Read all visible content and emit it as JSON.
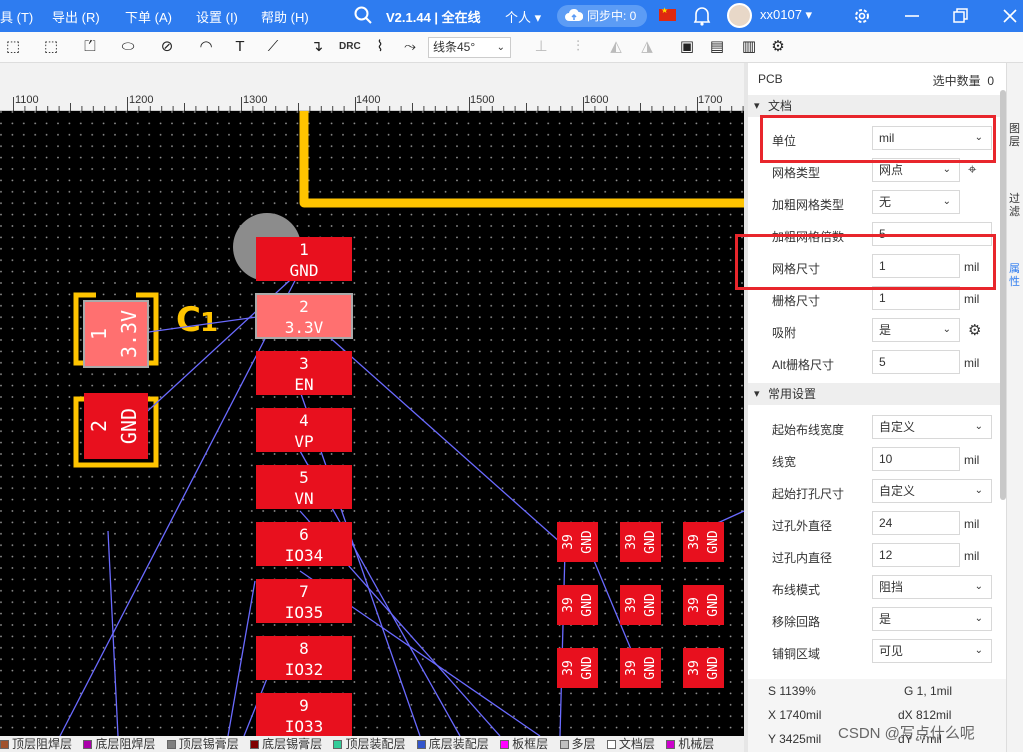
{
  "menubar": {
    "items": [
      "具 (T)",
      "导出 (R)",
      "下单 (A)",
      "设置 (I)",
      "帮助 (H)"
    ],
    "version": "V2.1.44 | 全在线",
    "account_mode": "个人",
    "sync": "同步中: 0",
    "username": "xx0107"
  },
  "toolbar": {
    "drc": "DRC",
    "line_mode": "线条45°"
  },
  "ruler": {
    "ticks": [
      "1100",
      "1200",
      "1300",
      "1400",
      "1500",
      "1600",
      "1700"
    ]
  },
  "canvas": {
    "pads_main": [
      {
        "num": "1",
        "net": "GND"
      },
      {
        "num": "2",
        "net": "3.3V"
      },
      {
        "num": "3",
        "net": "EN"
      },
      {
        "num": "4",
        "net": "VP"
      },
      {
        "num": "5",
        "net": "VN"
      },
      {
        "num": "6",
        "net": "IO34"
      },
      {
        "num": "7",
        "net": "IO35"
      },
      {
        "num": "8",
        "net": "IO32"
      },
      {
        "num": "9",
        "net": "IO33"
      }
    ],
    "cap_label": "C1",
    "cap_pads": [
      {
        "num": "1",
        "net": "3.3V"
      },
      {
        "num": "2",
        "net": "GND"
      }
    ],
    "grid_pad": {
      "num": "39",
      "net": "GND"
    }
  },
  "panel": {
    "title": "PCB",
    "selected_count_label": "选中数量",
    "selected_count": "0",
    "section_doc": "文档",
    "section_common": "常用设置",
    "doc_rows": [
      {
        "label": "单位",
        "value": "mil",
        "kind": "select"
      },
      {
        "label": "网格类型",
        "value": "网点",
        "kind": "select"
      },
      {
        "label": "加粗网格类型",
        "value": "无",
        "kind": "select"
      },
      {
        "label": "加粗网格倍数",
        "value": "5",
        "kind": "input"
      },
      {
        "label": "网格尺寸",
        "value": "1",
        "unit": "mil",
        "kind": "input"
      },
      {
        "label": "栅格尺寸",
        "value": "1",
        "unit": "mil",
        "kind": "input"
      },
      {
        "label": "吸附",
        "value": "是",
        "kind": "select"
      },
      {
        "label": "Alt栅格尺寸",
        "value": "5",
        "unit": "mil",
        "kind": "input"
      }
    ],
    "common_rows": [
      {
        "label": "起始布线宽度",
        "value": "自定义",
        "kind": "select"
      },
      {
        "label": "线宽",
        "value": "10",
        "unit": "mil",
        "kind": "input"
      },
      {
        "label": "起始打孔尺寸",
        "value": "自定义",
        "kind": "select"
      },
      {
        "label": "过孔外直径",
        "value": "24",
        "unit": "mil",
        "kind": "input"
      },
      {
        "label": "过孔内直径",
        "value": "12",
        "unit": "mil",
        "kind": "input"
      },
      {
        "label": "布线模式",
        "value": "阻挡",
        "kind": "select"
      },
      {
        "label": "移除回路",
        "value": "是",
        "kind": "select"
      },
      {
        "label": "铺铜区域",
        "value": "可见",
        "kind": "select"
      }
    ]
  },
  "status": {
    "s": "S  1139%",
    "g": "G  1, 1mil",
    "x": "X  1740mil",
    "dx": "dX  812mil",
    "y": "Y  3425mil",
    "dy": "dY  -7mil"
  },
  "sidetabs": [
    "图层",
    "过滤",
    "属性"
  ],
  "layers": [
    {
      "name": "顶层阻焊层",
      "color": "#a0522d"
    },
    {
      "name": "底层阻焊层",
      "color": "#aa00aa"
    },
    {
      "name": "顶层锡膏层",
      "color": "#808080"
    },
    {
      "name": "底层锡膏层",
      "color": "#800000"
    },
    {
      "name": "顶层装配层",
      "color": "#33cc99"
    },
    {
      "name": "底层装配层",
      "color": "#3355cc"
    },
    {
      "name": "板框层",
      "color": "#ff00ff"
    },
    {
      "name": "多层",
      "color": "#c0c0c0"
    },
    {
      "name": "文档层",
      "color": "#ffffff"
    },
    {
      "name": "机械层",
      "color": "#cc00cc"
    }
  ],
  "watermark": "CSDN @写点什么呢",
  "colors": {
    "accent": "#2e7cf0",
    "pad": "#e8101e",
    "track": "#ffc400",
    "ratline": "#6a6aff",
    "highlight": "#e8262c"
  }
}
